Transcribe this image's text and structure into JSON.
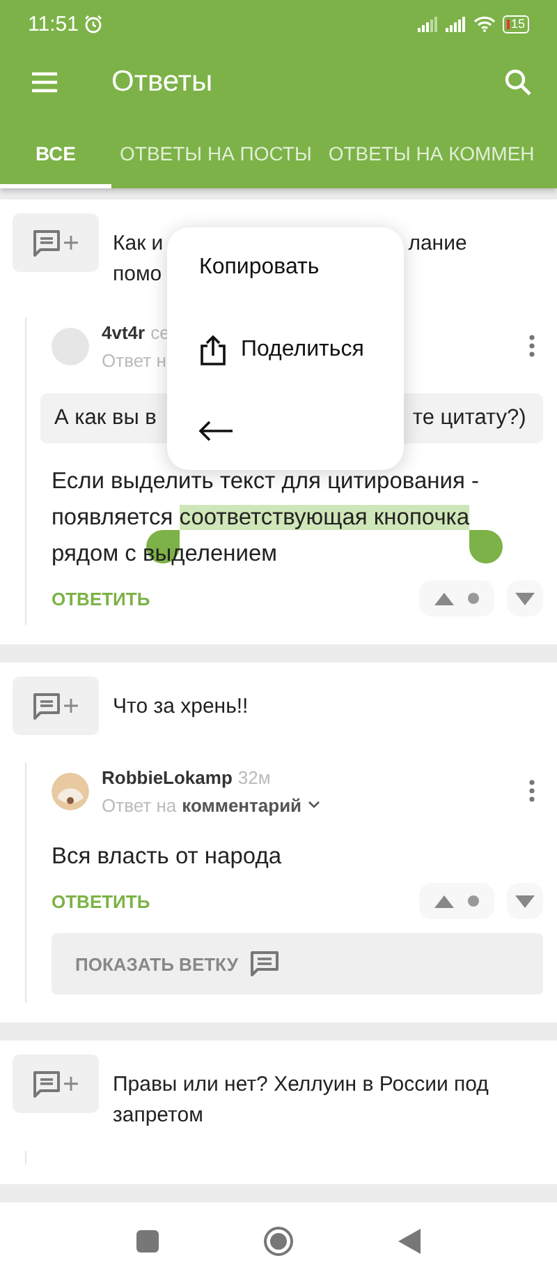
{
  "status_bar": {
    "time": "11:51",
    "battery": "15"
  },
  "toolbar": {
    "title": "Ответы"
  },
  "tabs": [
    {
      "label": "ВСЕ",
      "selected": true
    },
    {
      "label": "ОТВЕТЫ НА ПОСТЫ",
      "selected": false
    },
    {
      "label": "ОТВЕТЫ НА КОММЕН",
      "selected": false
    }
  ],
  "posts": [
    {
      "title_lines": [
        [
          "Как и",
          "лание"
        ],
        [
          "помо"
        ]
      ],
      "comment": {
        "photo_avatar": false,
        "author": "4vt4r",
        "time": "се",
        "reply_prefix": "Ответ н",
        "quote_parts": [
          "А как вы в",
          "те цитату?)"
        ],
        "body": [
          {
            "text": "Если выделить текст для цитирования - появляется ",
            "selected": false
          },
          {
            "text": "соответствующая кнопочка",
            "selected": true
          },
          {
            "text": " рядом с выделением",
            "selected": false
          }
        ],
        "reply_label": "ОТВЕТИТЬ"
      }
    },
    {
      "title_lines": [
        [
          "Что за хрень!!"
        ]
      ],
      "comment": {
        "photo_avatar": true,
        "author": "RobbieLokamp",
        "time": "32м",
        "reply_prefix": "Ответ на",
        "reply_target": "комментарий",
        "body": [
          {
            "text": "Вся власть от народа",
            "selected": false
          }
        ],
        "reply_label": "ОТВЕТИТЬ",
        "show_thread": "ПОКАЗАТЬ ВЕТКУ"
      }
    },
    {
      "title_lines": [
        [
          "Правы или нет? Хеллуин в России под"
        ],
        [
          "запретом"
        ]
      ]
    }
  ],
  "context_menu": [
    {
      "kind": "text",
      "label": "Копировать"
    },
    {
      "kind": "share",
      "label": "Поделиться"
    },
    {
      "kind": "back"
    }
  ]
}
